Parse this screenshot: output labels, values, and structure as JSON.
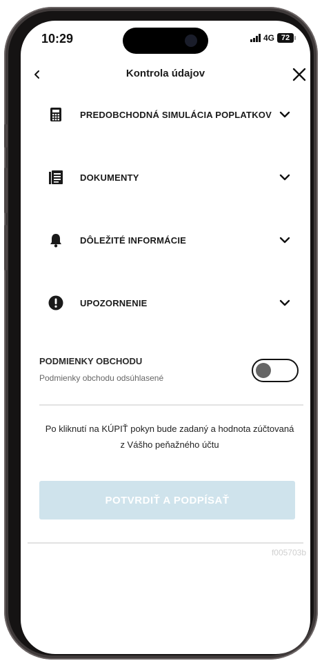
{
  "status_bar": {
    "time": "10:29",
    "network": "4G",
    "battery": "72"
  },
  "header": {
    "title": "Kontrola údajov"
  },
  "sections": [
    {
      "label": "PREDOBCHODNÁ SIMULÁCIA POPLATKOV",
      "icon": "calculator-icon"
    },
    {
      "label": "DOKUMENTY",
      "icon": "document-icon"
    },
    {
      "label": "DÔLEŽITÉ INFORMÁCIE",
      "icon": "bell-icon"
    },
    {
      "label": "UPOZORNENIE",
      "icon": "exclamation-icon"
    }
  ],
  "terms": {
    "title": "PODMIENKY OBCHODU",
    "subtitle": "Podmienky obchodu odsúhlasené",
    "toggle_on": false
  },
  "info_text_line1": "Po kliknutí na KÚPIŤ pokyn bude zadaný a hodnota zúčtovaná",
  "info_text_line2": "z Vášho peňažného účtu",
  "confirm_button": "POTVRDIŤ A PODPÍSAŤ",
  "screen_code": "f005703b",
  "colors": {
    "cta_disabled_bg": "#cfe3ec",
    "cta_text": "#ffffff",
    "frame": "#3f3a3a"
  }
}
